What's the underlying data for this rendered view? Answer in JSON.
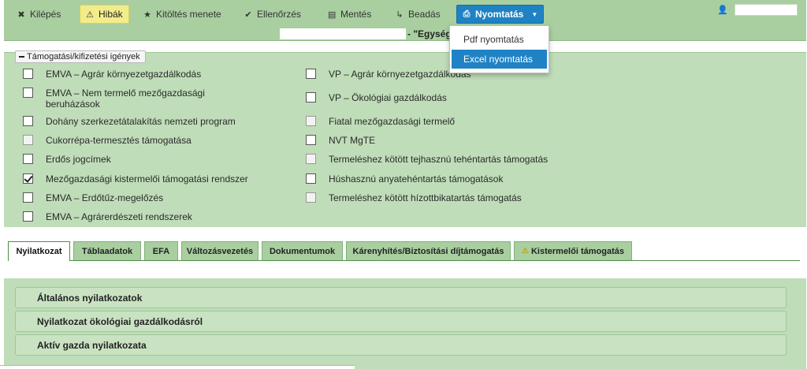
{
  "toolbar": {
    "items": [
      {
        "label": "Kilépés",
        "icon": "close-icon"
      },
      {
        "label": "Hibák",
        "icon": "warning-icon"
      },
      {
        "label": "Kitöltés menete",
        "icon": "star-icon"
      },
      {
        "label": "Ellenőrzés",
        "icon": "check-icon"
      },
      {
        "label": "Mentés",
        "icon": "save-icon"
      },
      {
        "label": "Beadás",
        "icon": "submit-icon"
      },
      {
        "label": "Nyomtatás",
        "icon": "print-icon"
      }
    ],
    "title_suffix": "- \"Egység",
    "user_icon": "user-icon"
  },
  "print_menu": {
    "items": [
      "Pdf nyomtatás",
      "Excel nyomtatás"
    ],
    "active_index": 1
  },
  "claims": {
    "toggle_label": "Támogatási/kifizetési igények",
    "left": [
      {
        "label": "EMVA – Agrár környezetgazdálkodás",
        "checked": false,
        "disabled": false
      },
      {
        "label": "EMVA – Nem termelő mezőgazdasági beruházások",
        "checked": false,
        "disabled": false
      },
      {
        "label": "Dohány szerkezetátalakítás nemzeti program",
        "checked": false,
        "disabled": false
      },
      {
        "label": "Cukorrépa-termesztés támogatása",
        "checked": false,
        "disabled": true
      },
      {
        "label": "Erdős jogcímek",
        "checked": false,
        "disabled": false
      },
      {
        "label": "Mezőgazdasági kistermelői támogatási rendszer",
        "checked": true,
        "disabled": false
      },
      {
        "label": "EMVA – Erdőtűz-megelőzés",
        "checked": false,
        "disabled": false
      },
      {
        "label": "EMVA – Agrárerdészeti rendszerek",
        "checked": false,
        "disabled": false
      }
    ],
    "right": [
      {
        "label": "VP – Agrár környezetgazdálkodás",
        "checked": false,
        "disabled": false
      },
      {
        "label": "VP – Ökológiai gazdálkodás",
        "checked": false,
        "disabled": false
      },
      {
        "label": "Fiatal mezőgazdasági termelő",
        "checked": false,
        "disabled": true
      },
      {
        "label": "NVT MgTE",
        "checked": false,
        "disabled": false
      },
      {
        "label": "Termeléshez kötött tejhasznú tehéntartás támogatás",
        "checked": false,
        "disabled": true
      },
      {
        "label": "Húshasznú anyatehéntartás támogatások",
        "checked": false,
        "disabled": false
      },
      {
        "label": "Termeléshez kötött hízottbikatartás támogatás",
        "checked": false,
        "disabled": true
      }
    ]
  },
  "tabs": [
    {
      "label": "Nyilatkozat",
      "active": true
    },
    {
      "label": "Táblaadatok",
      "active": false
    },
    {
      "label": "EFA",
      "active": false
    },
    {
      "label": "Változásvezetés",
      "active": false
    },
    {
      "label": "Dokumentumok",
      "active": false
    },
    {
      "label": "Kárenyhítés/Biztosítási díjtámogatás",
      "active": false
    },
    {
      "label": "Kistermelői támogatás",
      "active": false,
      "icon": "warning-icon"
    }
  ],
  "declarations": [
    {
      "label": "Általános nyilatkozatok"
    },
    {
      "label": "Nyilatkozat ökológiai gazdálkodásról"
    },
    {
      "label": "Aktív gazda nyilatkozata"
    }
  ]
}
